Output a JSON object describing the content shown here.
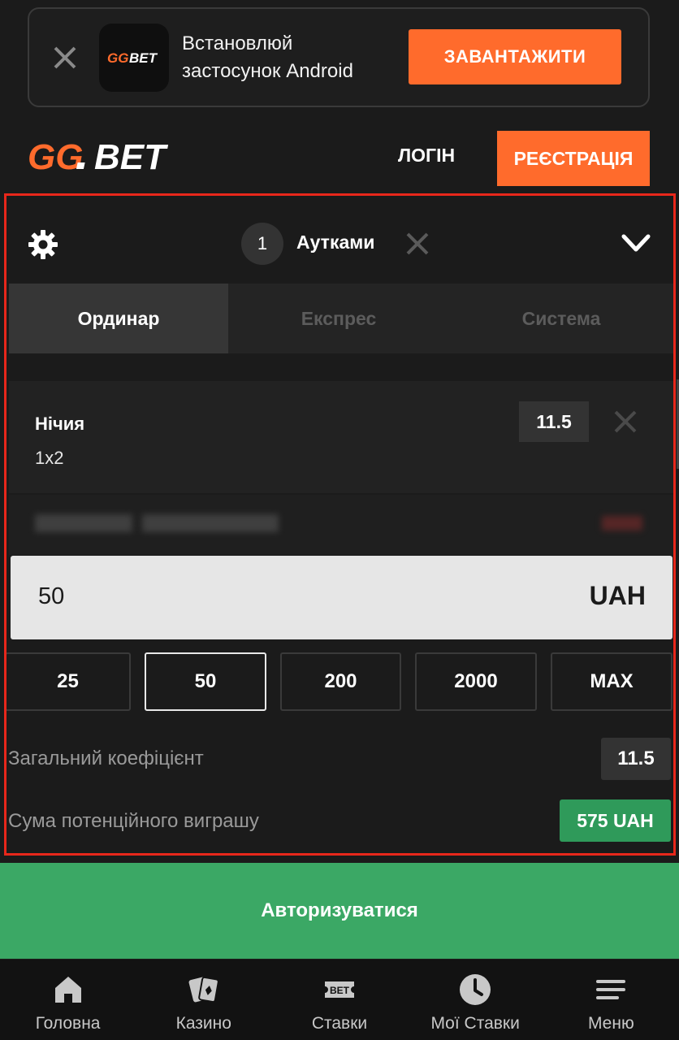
{
  "banner": {
    "app_icon_text": "GG.BET",
    "text_line1": "Встановлюй",
    "text_line2": "застосунок Android",
    "download_label": "ЗАВАНТАЖИТИ"
  },
  "header": {
    "logo": "GG.BET",
    "login_label": "ЛОГІН",
    "register_label": "РЕЄСТРАЦІЯ"
  },
  "betslip": {
    "count": "1",
    "title": "Аутками",
    "tabs": [
      {
        "label": "Ординар",
        "active": true
      },
      {
        "label": "Експрес",
        "active": false
      },
      {
        "label": "Система",
        "active": false
      }
    ],
    "selection": {
      "name": "Нічия",
      "market": "1x2",
      "odds": "11.5"
    },
    "stake": {
      "value": "50",
      "currency": "UAH"
    },
    "quick_amounts": [
      {
        "label": "25",
        "active": false
      },
      {
        "label": "50",
        "active": true
      },
      {
        "label": "200",
        "active": false
      },
      {
        "label": "2000",
        "active": false
      },
      {
        "label": "MAX",
        "active": false
      }
    ],
    "total_odds_label": "Загальний коефіцієнт",
    "total_odds": "11.5",
    "potential_label": "Сума потенційного виграшу",
    "potential_value": "575 UAH"
  },
  "auth_button": "Авторизуватися",
  "bottom_nav": [
    {
      "label": "Головна",
      "icon": "home-icon"
    },
    {
      "label": "Казино",
      "icon": "cards-icon"
    },
    {
      "label": "Ставки",
      "icon": "bet-ticket-icon"
    },
    {
      "label": "Мої Ставки",
      "icon": "clock-icon"
    },
    {
      "label": "Меню",
      "icon": "menu-icon"
    }
  ],
  "colors": {
    "accent_orange": "#ff6b2c",
    "highlight_red": "#e8271b",
    "success_green": "#3ba865",
    "background": "#1b1b1b"
  }
}
